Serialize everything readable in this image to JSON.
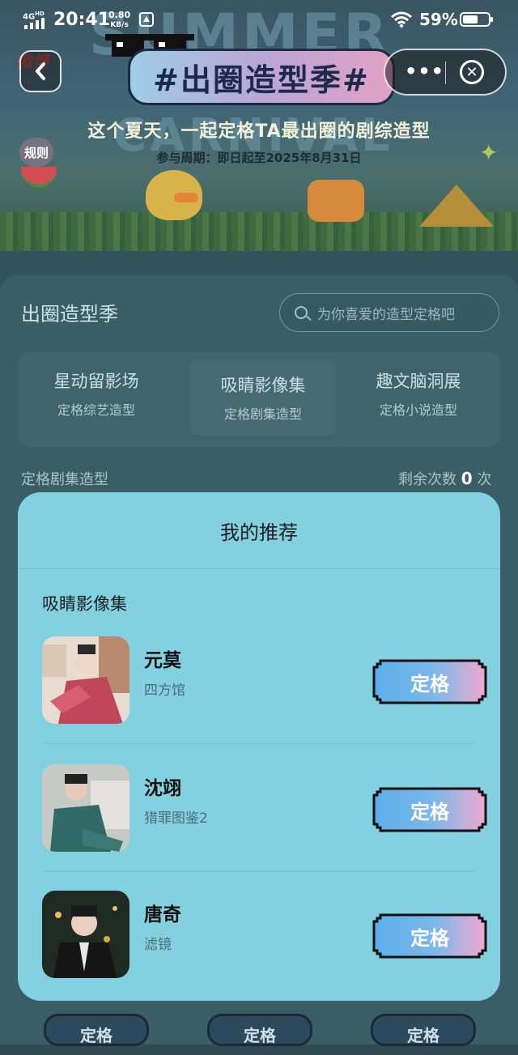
{
  "status_bar": {
    "network": "4G",
    "network_sup": "HD",
    "time": "20:41",
    "speed_value": "0.80",
    "speed_unit": "KB/s",
    "battery": "59%"
  },
  "banner": {
    "title": "#出圈造型季#",
    "subtitle": "这个夏天，一起定格TA最出圈的剧综造型",
    "period": "参与周期：即日起至2025年8月31日",
    "rules_label": "规则",
    "app_logo": "微博",
    "ghost_text_1": "SUMMER",
    "ghost_text_2": "CARNIVAL"
  },
  "nav": {
    "back_icon": "chevron-left",
    "more_label": "•••",
    "close_icon": "close-circle"
  },
  "page": {
    "section_title": "出圈造型季",
    "search_placeholder": "为你喜爱的造型定格吧",
    "tabs": [
      {
        "title": "星动留影场",
        "subtitle": "定格综艺造型",
        "active": false
      },
      {
        "title": "吸睛影像集",
        "subtitle": "定格剧集造型",
        "active": true
      },
      {
        "title": "趣文脑洞展",
        "subtitle": "定格小说造型",
        "active": false
      }
    ],
    "list_label": "定格剧集造型",
    "remaining_prefix": "剩余次数",
    "remaining_count": "0",
    "remaining_suffix": "次",
    "bottom_buttons": [
      "定格",
      "定格",
      "定格"
    ]
  },
  "sheet": {
    "title": "我的推荐",
    "category": "吸睛影像集",
    "items": [
      {
        "name": "元莫",
        "show": "四方馆",
        "button": "定格"
      },
      {
        "name": "沈翊",
        "show": "猎罪图鉴2",
        "button": "定格"
      },
      {
        "name": "唐奇",
        "show": "滤镜",
        "button": "定格"
      }
    ]
  },
  "colors": {
    "sheet_bg": "#82d0e0",
    "button_gradient_start": "#5aaeea",
    "button_gradient_end": "#f0a8d0",
    "overlay": "#2f4a51"
  }
}
